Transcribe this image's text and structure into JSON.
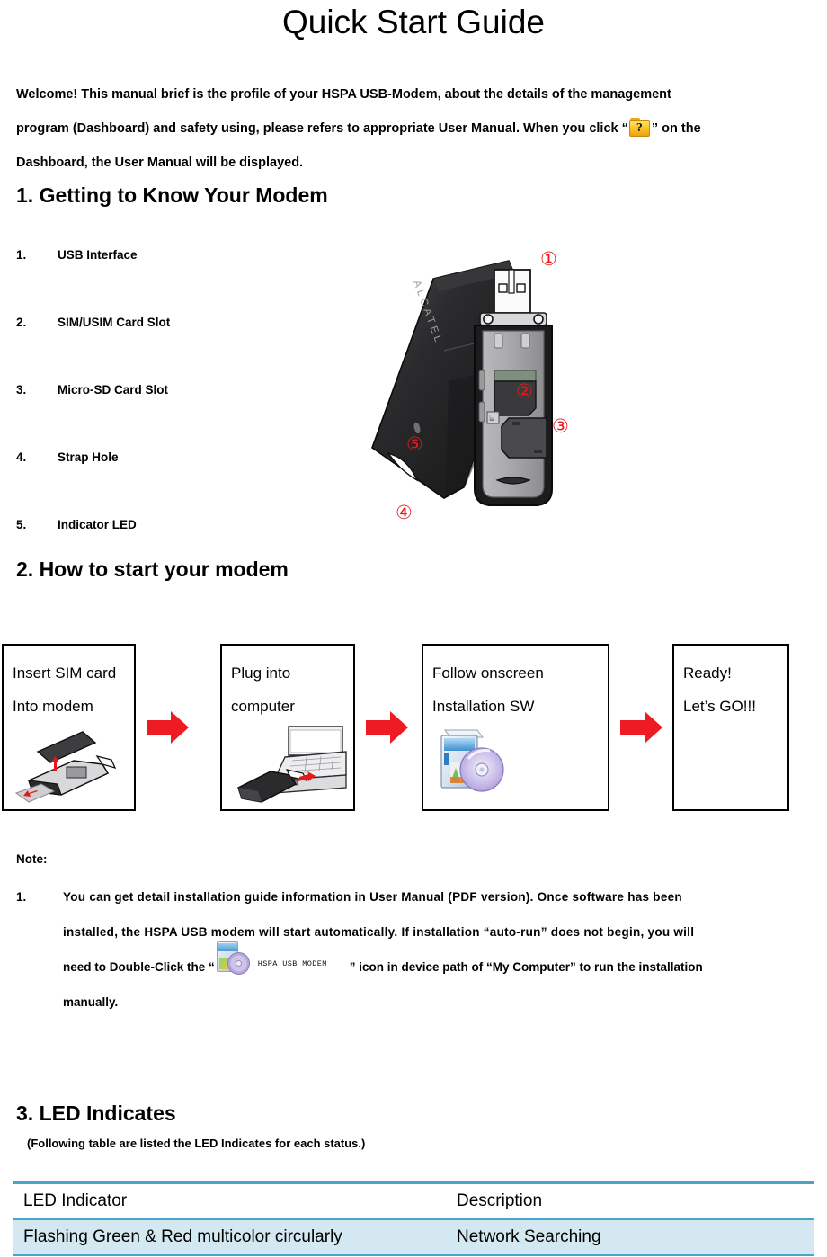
{
  "document": {
    "title": "Quick Start Guide"
  },
  "intro": {
    "line1": "Welcome! This manual brief is the profile of your HSPA USB-Modem, about the details of the management",
    "line2_before": "program (Dashboard) and safety using, please refers to appropriate User Manual. When you click “",
    "help_icon_name": "help-folder-icon",
    "help_icon_glyph": "?",
    "line2_after": "” on the",
    "line3": "Dashboard, the User Manual will be displayed."
  },
  "sections": {
    "getting_to_know": "1. Getting to Know Your Modem",
    "how_to_start": "2. How to start your modem",
    "led_indicates": "3. LED Indicates"
  },
  "features": [
    {
      "num": "1.",
      "label": "USB Interface"
    },
    {
      "num": "2.",
      "label": "SIM/USIM Card Slot"
    },
    {
      "num": "3.",
      "label": "Micro-SD Card Slot"
    },
    {
      "num": "4.",
      "label": "Strap Hole"
    },
    {
      "num": "5.",
      "label": "Indicator LED"
    }
  ],
  "modem_image": {
    "brand_text": "ALCATEL",
    "callouts": [
      "①",
      "②",
      "③",
      "④",
      "⑤"
    ]
  },
  "steps": [
    {
      "line1": "Insert SIM card",
      "line2": "Into modem",
      "art": "sim-insert-art"
    },
    {
      "line1": "Plug into",
      "line2": "computer",
      "art": "laptop-plug-art"
    },
    {
      "line1": "Follow onscreen",
      "line2": "Installation SW",
      "art": "installer-cd-art"
    },
    {
      "line1": "Ready!",
      "line2": "Let’s GO!!!",
      "art": ""
    }
  ],
  "note": {
    "label": "Note:",
    "num": "1.",
    "line1": "You can  get  detail  installation  guide  information  in  User  Manual  (PDF  version).  Once  software  has  been",
    "line2": "installed,  the  HSPA  USB  modem  will  start automatically.  If  installation  “auto-run”  does  not  begin,  you  will",
    "line3_before": "need to Double-Click the “",
    "sw_icon_label": "HSPA USB MODEM",
    "line3_after": "” icon in device path of “My Computer” to run the installation",
    "line4": "manually."
  },
  "table": {
    "caption": "(Following table are listed the LED Indicates for each status.)",
    "headers": [
      "LED Indicator",
      "Description"
    ],
    "rows": [
      [
        "Flashing Green & Red multicolor circularly",
        "Network Searching"
      ]
    ],
    "accent_color": "#4BA3C7",
    "row_fill_color": "#D3E8F0"
  }
}
